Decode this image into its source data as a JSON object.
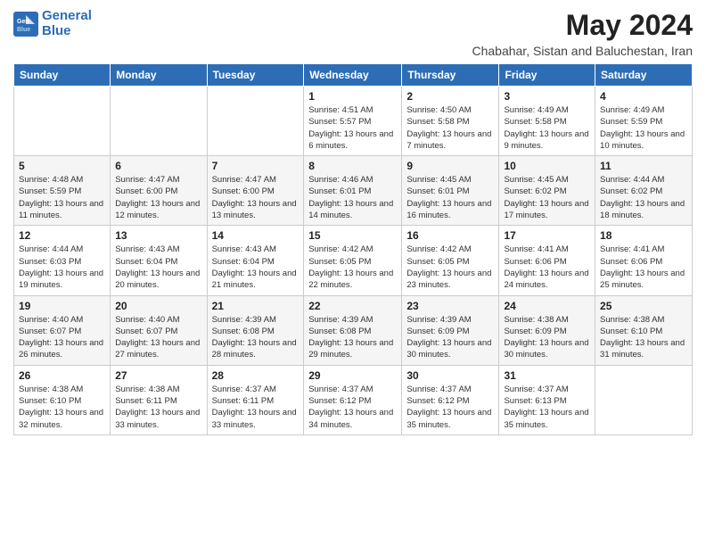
{
  "logo": {
    "line1": "General",
    "line2": "Blue"
  },
  "title": {
    "month": "May 2024",
    "location": "Chabahar, Sistan and Baluchestan, Iran"
  },
  "weekdays": [
    "Sunday",
    "Monday",
    "Tuesday",
    "Wednesday",
    "Thursday",
    "Friday",
    "Saturday"
  ],
  "weeks": [
    [
      {
        "day": "",
        "info": ""
      },
      {
        "day": "",
        "info": ""
      },
      {
        "day": "",
        "info": ""
      },
      {
        "day": "1",
        "info": "Sunrise: 4:51 AM\nSunset: 5:57 PM\nDaylight: 13 hours and 6 minutes."
      },
      {
        "day": "2",
        "info": "Sunrise: 4:50 AM\nSunset: 5:58 PM\nDaylight: 13 hours and 7 minutes."
      },
      {
        "day": "3",
        "info": "Sunrise: 4:49 AM\nSunset: 5:58 PM\nDaylight: 13 hours and 9 minutes."
      },
      {
        "day": "4",
        "info": "Sunrise: 4:49 AM\nSunset: 5:59 PM\nDaylight: 13 hours and 10 minutes."
      }
    ],
    [
      {
        "day": "5",
        "info": "Sunrise: 4:48 AM\nSunset: 5:59 PM\nDaylight: 13 hours and 11 minutes."
      },
      {
        "day": "6",
        "info": "Sunrise: 4:47 AM\nSunset: 6:00 PM\nDaylight: 13 hours and 12 minutes."
      },
      {
        "day": "7",
        "info": "Sunrise: 4:47 AM\nSunset: 6:00 PM\nDaylight: 13 hours and 13 minutes."
      },
      {
        "day": "8",
        "info": "Sunrise: 4:46 AM\nSunset: 6:01 PM\nDaylight: 13 hours and 14 minutes."
      },
      {
        "day": "9",
        "info": "Sunrise: 4:45 AM\nSunset: 6:01 PM\nDaylight: 13 hours and 16 minutes."
      },
      {
        "day": "10",
        "info": "Sunrise: 4:45 AM\nSunset: 6:02 PM\nDaylight: 13 hours and 17 minutes."
      },
      {
        "day": "11",
        "info": "Sunrise: 4:44 AM\nSunset: 6:02 PM\nDaylight: 13 hours and 18 minutes."
      }
    ],
    [
      {
        "day": "12",
        "info": "Sunrise: 4:44 AM\nSunset: 6:03 PM\nDaylight: 13 hours and 19 minutes."
      },
      {
        "day": "13",
        "info": "Sunrise: 4:43 AM\nSunset: 6:04 PM\nDaylight: 13 hours and 20 minutes."
      },
      {
        "day": "14",
        "info": "Sunrise: 4:43 AM\nSunset: 6:04 PM\nDaylight: 13 hours and 21 minutes."
      },
      {
        "day": "15",
        "info": "Sunrise: 4:42 AM\nSunset: 6:05 PM\nDaylight: 13 hours and 22 minutes."
      },
      {
        "day": "16",
        "info": "Sunrise: 4:42 AM\nSunset: 6:05 PM\nDaylight: 13 hours and 23 minutes."
      },
      {
        "day": "17",
        "info": "Sunrise: 4:41 AM\nSunset: 6:06 PM\nDaylight: 13 hours and 24 minutes."
      },
      {
        "day": "18",
        "info": "Sunrise: 4:41 AM\nSunset: 6:06 PM\nDaylight: 13 hours and 25 minutes."
      }
    ],
    [
      {
        "day": "19",
        "info": "Sunrise: 4:40 AM\nSunset: 6:07 PM\nDaylight: 13 hours and 26 minutes."
      },
      {
        "day": "20",
        "info": "Sunrise: 4:40 AM\nSunset: 6:07 PM\nDaylight: 13 hours and 27 minutes."
      },
      {
        "day": "21",
        "info": "Sunrise: 4:39 AM\nSunset: 6:08 PM\nDaylight: 13 hours and 28 minutes."
      },
      {
        "day": "22",
        "info": "Sunrise: 4:39 AM\nSunset: 6:08 PM\nDaylight: 13 hours and 29 minutes."
      },
      {
        "day": "23",
        "info": "Sunrise: 4:39 AM\nSunset: 6:09 PM\nDaylight: 13 hours and 30 minutes."
      },
      {
        "day": "24",
        "info": "Sunrise: 4:38 AM\nSunset: 6:09 PM\nDaylight: 13 hours and 30 minutes."
      },
      {
        "day": "25",
        "info": "Sunrise: 4:38 AM\nSunset: 6:10 PM\nDaylight: 13 hours and 31 minutes."
      }
    ],
    [
      {
        "day": "26",
        "info": "Sunrise: 4:38 AM\nSunset: 6:10 PM\nDaylight: 13 hours and 32 minutes."
      },
      {
        "day": "27",
        "info": "Sunrise: 4:38 AM\nSunset: 6:11 PM\nDaylight: 13 hours and 33 minutes."
      },
      {
        "day": "28",
        "info": "Sunrise: 4:37 AM\nSunset: 6:11 PM\nDaylight: 13 hours and 33 minutes."
      },
      {
        "day": "29",
        "info": "Sunrise: 4:37 AM\nSunset: 6:12 PM\nDaylight: 13 hours and 34 minutes."
      },
      {
        "day": "30",
        "info": "Sunrise: 4:37 AM\nSunset: 6:12 PM\nDaylight: 13 hours and 35 minutes."
      },
      {
        "day": "31",
        "info": "Sunrise: 4:37 AM\nSunset: 6:13 PM\nDaylight: 13 hours and 35 minutes."
      },
      {
        "day": "",
        "info": ""
      }
    ]
  ]
}
